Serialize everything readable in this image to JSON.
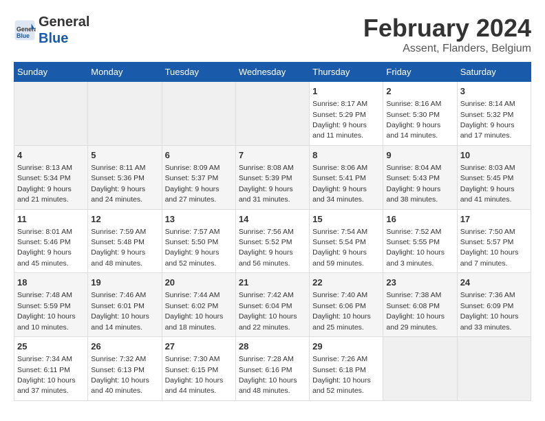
{
  "header": {
    "logo_line1": "General",
    "logo_line2": "Blue",
    "title": "February 2024",
    "subtitle": "Assent, Flanders, Belgium"
  },
  "weekdays": [
    "Sunday",
    "Monday",
    "Tuesday",
    "Wednesday",
    "Thursday",
    "Friday",
    "Saturday"
  ],
  "weeks": [
    [
      {
        "day": "",
        "info": ""
      },
      {
        "day": "",
        "info": ""
      },
      {
        "day": "",
        "info": ""
      },
      {
        "day": "",
        "info": ""
      },
      {
        "day": "1",
        "info": "Sunrise: 8:17 AM\nSunset: 5:29 PM\nDaylight: 9 hours\nand 11 minutes."
      },
      {
        "day": "2",
        "info": "Sunrise: 8:16 AM\nSunset: 5:30 PM\nDaylight: 9 hours\nand 14 minutes."
      },
      {
        "day": "3",
        "info": "Sunrise: 8:14 AM\nSunset: 5:32 PM\nDaylight: 9 hours\nand 17 minutes."
      }
    ],
    [
      {
        "day": "4",
        "info": "Sunrise: 8:13 AM\nSunset: 5:34 PM\nDaylight: 9 hours\nand 21 minutes."
      },
      {
        "day": "5",
        "info": "Sunrise: 8:11 AM\nSunset: 5:36 PM\nDaylight: 9 hours\nand 24 minutes."
      },
      {
        "day": "6",
        "info": "Sunrise: 8:09 AM\nSunset: 5:37 PM\nDaylight: 9 hours\nand 27 minutes."
      },
      {
        "day": "7",
        "info": "Sunrise: 8:08 AM\nSunset: 5:39 PM\nDaylight: 9 hours\nand 31 minutes."
      },
      {
        "day": "8",
        "info": "Sunrise: 8:06 AM\nSunset: 5:41 PM\nDaylight: 9 hours\nand 34 minutes."
      },
      {
        "day": "9",
        "info": "Sunrise: 8:04 AM\nSunset: 5:43 PM\nDaylight: 9 hours\nand 38 minutes."
      },
      {
        "day": "10",
        "info": "Sunrise: 8:03 AM\nSunset: 5:45 PM\nDaylight: 9 hours\nand 41 minutes."
      }
    ],
    [
      {
        "day": "11",
        "info": "Sunrise: 8:01 AM\nSunset: 5:46 PM\nDaylight: 9 hours\nand 45 minutes."
      },
      {
        "day": "12",
        "info": "Sunrise: 7:59 AM\nSunset: 5:48 PM\nDaylight: 9 hours\nand 48 minutes."
      },
      {
        "day": "13",
        "info": "Sunrise: 7:57 AM\nSunset: 5:50 PM\nDaylight: 9 hours\nand 52 minutes."
      },
      {
        "day": "14",
        "info": "Sunrise: 7:56 AM\nSunset: 5:52 PM\nDaylight: 9 hours\nand 56 minutes."
      },
      {
        "day": "15",
        "info": "Sunrise: 7:54 AM\nSunset: 5:54 PM\nDaylight: 9 hours\nand 59 minutes."
      },
      {
        "day": "16",
        "info": "Sunrise: 7:52 AM\nSunset: 5:55 PM\nDaylight: 10 hours\nand 3 minutes."
      },
      {
        "day": "17",
        "info": "Sunrise: 7:50 AM\nSunset: 5:57 PM\nDaylight: 10 hours\nand 7 minutes."
      }
    ],
    [
      {
        "day": "18",
        "info": "Sunrise: 7:48 AM\nSunset: 5:59 PM\nDaylight: 10 hours\nand 10 minutes."
      },
      {
        "day": "19",
        "info": "Sunrise: 7:46 AM\nSunset: 6:01 PM\nDaylight: 10 hours\nand 14 minutes."
      },
      {
        "day": "20",
        "info": "Sunrise: 7:44 AM\nSunset: 6:02 PM\nDaylight: 10 hours\nand 18 minutes."
      },
      {
        "day": "21",
        "info": "Sunrise: 7:42 AM\nSunset: 6:04 PM\nDaylight: 10 hours\nand 22 minutes."
      },
      {
        "day": "22",
        "info": "Sunrise: 7:40 AM\nSunset: 6:06 PM\nDaylight: 10 hours\nand 25 minutes."
      },
      {
        "day": "23",
        "info": "Sunrise: 7:38 AM\nSunset: 6:08 PM\nDaylight: 10 hours\nand 29 minutes."
      },
      {
        "day": "24",
        "info": "Sunrise: 7:36 AM\nSunset: 6:09 PM\nDaylight: 10 hours\nand 33 minutes."
      }
    ],
    [
      {
        "day": "25",
        "info": "Sunrise: 7:34 AM\nSunset: 6:11 PM\nDaylight: 10 hours\nand 37 minutes."
      },
      {
        "day": "26",
        "info": "Sunrise: 7:32 AM\nSunset: 6:13 PM\nDaylight: 10 hours\nand 40 minutes."
      },
      {
        "day": "27",
        "info": "Sunrise: 7:30 AM\nSunset: 6:15 PM\nDaylight: 10 hours\nand 44 minutes."
      },
      {
        "day": "28",
        "info": "Sunrise: 7:28 AM\nSunset: 6:16 PM\nDaylight: 10 hours\nand 48 minutes."
      },
      {
        "day": "29",
        "info": "Sunrise: 7:26 AM\nSunset: 6:18 PM\nDaylight: 10 hours\nand 52 minutes."
      },
      {
        "day": "",
        "info": ""
      },
      {
        "day": "",
        "info": ""
      }
    ]
  ]
}
